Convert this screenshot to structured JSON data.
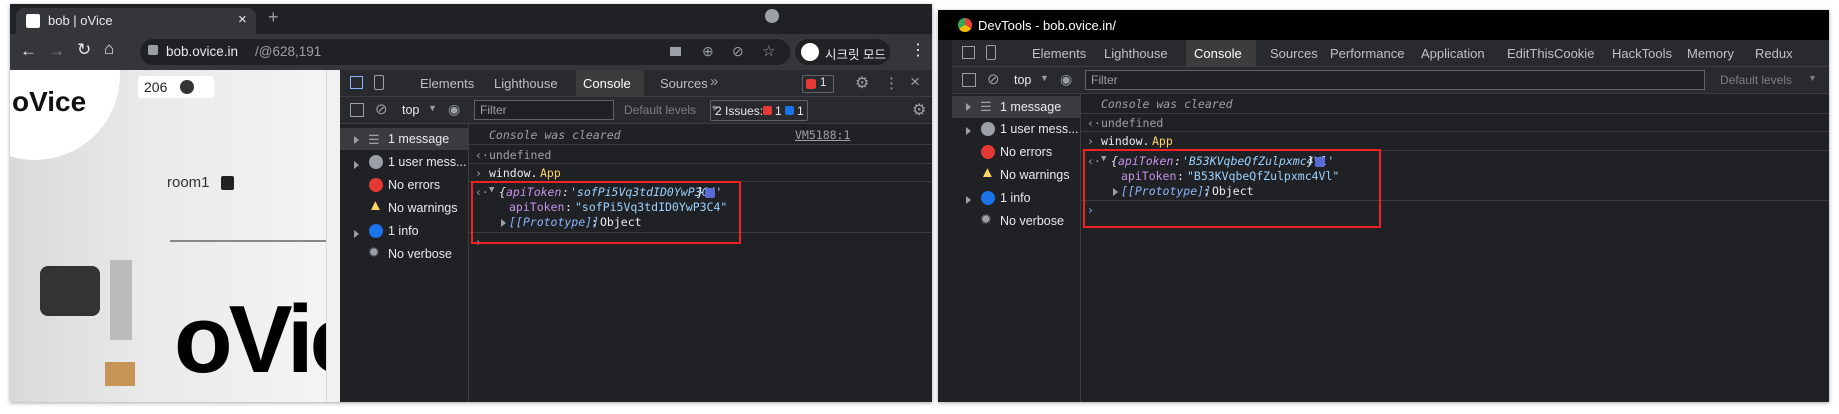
{
  "left": {
    "browser": {
      "tab_title": "bob | oVice",
      "url_host": "bob.ovice.in",
      "url_path": "/@628,191",
      "incognito_label": "시크릿 모드"
    },
    "page": {
      "logo": "oVice",
      "count": "206",
      "room_label": "room1",
      "big_logo": "oVic"
    },
    "devtools": {
      "tabs": [
        "Elements",
        "Lighthouse",
        "Console",
        "Sources"
      ],
      "active_tab": "Console",
      "error_count": "1",
      "context": "top",
      "filter_placeholder": "Filter",
      "levels": "Default levels",
      "issues_label": "2 Issues:",
      "issues_error": "1",
      "issues_info": "1",
      "sidebar": [
        {
          "label": "1 message",
          "icon": "list-icon"
        },
        {
          "label": "1 user mess...",
          "icon": "user-icon"
        },
        {
          "label": "No errors",
          "icon": "error-icon"
        },
        {
          "label": "No warnings",
          "icon": "warning-icon"
        },
        {
          "label": "1 info",
          "icon": "info-icon"
        },
        {
          "label": "No verbose",
          "icon": "bug-icon"
        }
      ],
      "console": {
        "cleared": "Console was cleared",
        "source": "VM5188:1",
        "undefined": "undefined",
        "cmd_obj": "window.",
        "cmd_prop": "App",
        "obj_key": "apiToken",
        "obj_val_short": "'sofPi5Vq3tdID0YwP3C4'",
        "obj_val_full": "\"sofPi5Vq3tdID0YwP3C4\"",
        "proto": "[[Prototype]]",
        "proto_val": "Object"
      }
    }
  },
  "right": {
    "window_title": "DevTools - bob.ovice.in/",
    "devtools": {
      "tabs": [
        "Elements",
        "Lighthouse",
        "Console",
        "Sources",
        "Performance",
        "Application",
        "EditThisCookie",
        "HackTools",
        "Memory",
        "Redux"
      ],
      "active_tab": "Console",
      "context": "top",
      "filter_placeholder": "Filter",
      "levels": "Default levels",
      "sidebar": [
        {
          "label": "1 message",
          "icon": "list-icon"
        },
        {
          "label": "1 user mess...",
          "icon": "user-icon"
        },
        {
          "label": "No errors",
          "icon": "error-icon"
        },
        {
          "label": "No warnings",
          "icon": "warning-icon"
        },
        {
          "label": "1 info",
          "icon": "info-icon"
        },
        {
          "label": "No verbose",
          "icon": "bug-icon"
        }
      ],
      "console": {
        "cleared": "Console was cleared",
        "undefined": "undefined",
        "cmd_obj": "window.",
        "cmd_prop": "App",
        "obj_key": "apiToken",
        "obj_val_short": "'B53KVqbeQfZulpxmc4Vl'",
        "obj_val_full": "\"B53KVqbeQfZulpxmc4Vl\"",
        "proto": "[[Prototype]]",
        "proto_val": "Object"
      }
    }
  },
  "colors": {
    "highlight_box": "#e22222",
    "string": "#9ad1ff",
    "key": "#c792ea",
    "error": "#f28b82",
    "warning": "#fdd663",
    "info": "#8ab4f8"
  }
}
